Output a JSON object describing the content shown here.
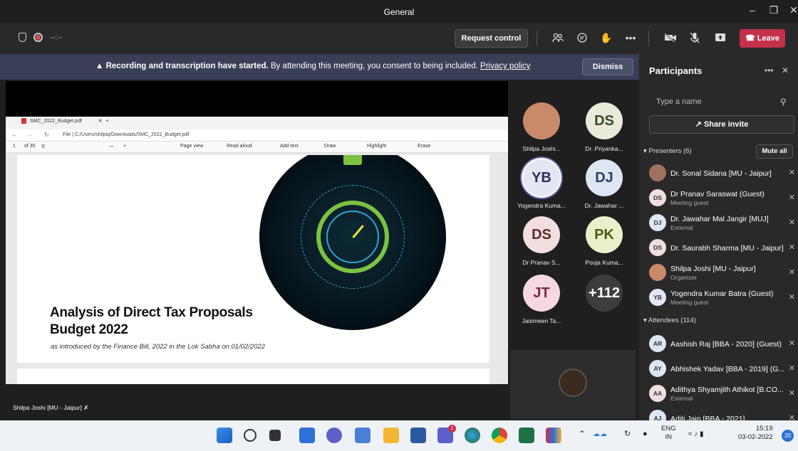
{
  "window": {
    "title": "General"
  },
  "toolbar": {
    "timer": "--:--",
    "request_control": "Request control",
    "leave": "Leave"
  },
  "banner": {
    "bold": "Recording and transcription have started.",
    "text": "By attending this meeting, you consent to being included.",
    "link": "Privacy policy",
    "dismiss": "Dismiss"
  },
  "pdf": {
    "tab_title": "SMC_2022_Budget.pdf",
    "address": "File  |  C:/Users/shilpaj/Downloads/SMC_2022_Budget.pdf",
    "page_num": "1",
    "page_total": "of 35",
    "tools": [
      "Page view",
      "Read aloud",
      "Add text",
      "Draw",
      "Highlight",
      "Erase"
    ],
    "doc_title_1": "Analysis of Direct Tax Proposals",
    "doc_title_2": "Budget 2022",
    "doc_subtitle": "as introduced by the Finance Bill, 2022 in the Lok Sabha on 01/02/2022"
  },
  "stage_label": "Shilpa Joshi [MU - Jaipur]",
  "gallery": [
    {
      "initials": "",
      "name": "Shilpa Joshi...",
      "bg": "#c98a6a",
      "color": "#fff"
    },
    {
      "initials": "DS",
      "name": "Dr. Priyanka...",
      "bg": "#e9ead9",
      "color": "#3b4a2a"
    },
    {
      "initials": "YB",
      "name": "Yogendra Kuma...",
      "bg": "#e3e6f3",
      "color": "#2b2f5a"
    },
    {
      "initials": "DJ",
      "name": "Dr. Jawahar ...",
      "bg": "#dde6f2",
      "color": "#2b3f6a"
    },
    {
      "initials": "DS",
      "name": "Dr Pranav S...",
      "bg": "#f2dede",
      "color": "#5a2b2b"
    },
    {
      "initials": "PK",
      "name": "Pooja Kuma...",
      "bg": "#eaf0c9",
      "color": "#4a5a1a"
    },
    {
      "initials": "JT",
      "name": "Jaismeen Ta...",
      "bg": "#f6d9e0",
      "color": "#7a2a3e"
    },
    {
      "initials": "+112",
      "name": "",
      "bg": "#3d3d3d",
      "color": "#fff"
    }
  ],
  "panel": {
    "title": "Participants",
    "search_placeholder": "Type a name",
    "share_invite": "Share invite",
    "presenters_label": "Presenters (6)",
    "mute_all": "Mute all",
    "attendees_label": "Attendees (114)",
    "presenters": [
      {
        "initials": "",
        "name": "Dr. Sonal Sidana [MU - Jaipur]",
        "sub": "",
        "bg": "#a07060"
      },
      {
        "initials": "DS",
        "name": "Dr Pranav Saraswat (Guest)",
        "sub": "Meeting guest",
        "bg": "#f2dede"
      },
      {
        "initials": "DJ",
        "name": "Dr. Jawahar Mal Jangir [MUJ]",
        "sub": "External",
        "bg": "#dde6f2"
      },
      {
        "initials": "DS",
        "name": "Dr. Saurabh Sharma [MU - Jaipur]",
        "sub": "",
        "bg": "#f2dede"
      },
      {
        "initials": "",
        "name": "Shilpa Joshi [MU - Jaipur]",
        "sub": "Organizer",
        "bg": "#c98a6a"
      },
      {
        "initials": "YB",
        "name": "Yogendra Kumar Batra (Guest)",
        "sub": "Meeting guest",
        "bg": "#e3e6f3"
      }
    ],
    "attendees": [
      {
        "initials": "AR",
        "name": "Aashish Raj [BBA - 2020] (Guest)",
        "sub": "",
        "bg": "#dde6f2"
      },
      {
        "initials": "AY",
        "name": "Abhishek Yadav [BBA - 2019] (G...",
        "sub": "",
        "bg": "#dde6f2"
      },
      {
        "initials": "AA",
        "name": "Adithya Shyamjith Athikot [B.CO...",
        "sub": "External",
        "bg": "#f2dede"
      },
      {
        "initials": "AJ",
        "name": "Aditi Jain [BBA - 2021]",
        "sub": "",
        "bg": "#dde6f2"
      }
    ]
  },
  "taskbar": {
    "lang_1": "ENG",
    "lang_2": "IN",
    "time": "15:19",
    "date": "03-02-2022",
    "badge": "20",
    "teams_badge": "1"
  }
}
